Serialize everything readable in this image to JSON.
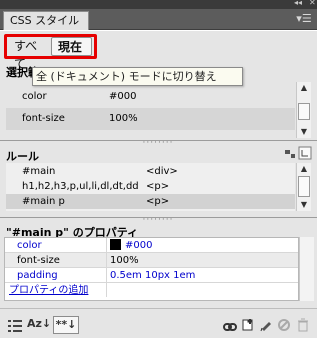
{
  "window": {
    "collapse_glyph": "◂◂",
    "close_glyph": "✕",
    "tab_label": "CSS スタイル",
    "menu_glyph": "▾☰"
  },
  "mode": {
    "all_label": "すべて",
    "current_label": "現在"
  },
  "summary": {
    "title": "選択範囲の",
    "tooltip": "全 (ドキュメント) モードに切り替え",
    "rows": [
      {
        "property": "color",
        "value": "#000"
      },
      {
        "property": "font-size",
        "value": "100%"
      }
    ]
  },
  "rules": {
    "title": "ルール",
    "rows": [
      {
        "selector": "#main",
        "tag": "<div>"
      },
      {
        "selector": "h1,h2,h3,p,ul,li,dl,dt,dd",
        "tag": "<p>"
      },
      {
        "selector": "#main p",
        "tag": "<p>"
      }
    ]
  },
  "properties": {
    "title": "\"#main p\" のプロパティ",
    "rows": [
      {
        "name": "color",
        "value": "#000",
        "swatch": "#000000"
      },
      {
        "name": "font-size",
        "value": "100%"
      },
      {
        "name": "padding",
        "value": "0.5em 10px 1em"
      }
    ],
    "add_link": "プロパティの追加"
  },
  "toolbar": {
    "az_label": "Az↓",
    "set_label": "**↓"
  },
  "colors": {
    "highlight": "#e60000",
    "link": "#0000cc",
    "selected_row": "#d2d2d2"
  },
  "icons": {
    "category_view": "category-view-icon",
    "alpha_view": "alpha-view-icon",
    "set_view": "set-properties-view-icon",
    "attach_stylesheet": "link-icon",
    "new_rule": "new-rule-icon",
    "edit_rule": "edit-icon",
    "disable_property": "disable-icon",
    "delete": "trash-icon"
  }
}
